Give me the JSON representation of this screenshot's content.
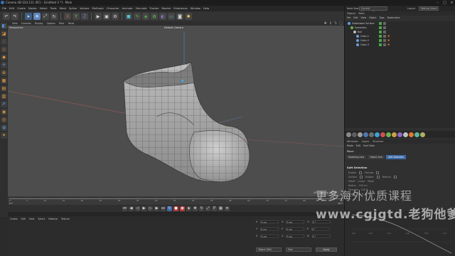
{
  "window": {
    "title": "Cinema 4D S24.111 (RC) - [Untitled 3 *] - Main"
  },
  "menubar": [
    "File",
    "Edit",
    "Create",
    "Modes",
    "Select",
    "Tools",
    "Mesh",
    "Spline",
    "Volume",
    "MoGraph",
    "Character",
    "Animate",
    "Simulate",
    "Tracker",
    "Render",
    "Extensions",
    "Window",
    "Help"
  ],
  "viewport": {
    "menu": [
      "View",
      "Cameras",
      "Display",
      "Options",
      "Filter",
      "Panel"
    ],
    "label": "Perspective",
    "camera": "Default Camera",
    "grid_spacing": "Grid Spacing : 50 cm"
  },
  "timeline": {
    "ticks": [
      "0",
      "5",
      "10",
      "15",
      "20",
      "25",
      "30",
      "35",
      "40",
      "45",
      "50",
      "55",
      "60",
      "65",
      "70",
      "75",
      "80",
      "85",
      "90"
    ],
    "start": "0 F",
    "end": "90 F"
  },
  "materials_menu": [
    "Create",
    "Edit",
    "View",
    "Select",
    "Material",
    "Texture"
  ],
  "coordinates": {
    "rows": [
      {
        "a": "X",
        "av": "0 cm",
        "b": "X",
        "bv": "0 cm",
        "c": "H",
        "cv": "0 °"
      },
      {
        "a": "Y",
        "av": "0 cm",
        "b": "Y",
        "bv": "0 cm",
        "c": "P",
        "cv": "0 °"
      },
      {
        "a": "Z",
        "av": "0 cm",
        "b": "Z",
        "bv": "0 cm",
        "c": "B",
        "cv": "0 °"
      }
    ],
    "mode": "Object (Rel)",
    "size_mode": "Size",
    "apply": "Apply"
  },
  "right_top": {
    "node_space_label": "Node Space",
    "node_space_value": "Current (Standard/Physical)",
    "layout_label": "Layout",
    "layout_value": "Startup (User)"
  },
  "object_tabs": [
    "Objects",
    "Takes"
  ],
  "object_menu": [
    "File",
    "Edit",
    "View",
    "Object",
    "Tags",
    "Bookmarks"
  ],
  "objects": [
    {
      "name": "Subdivision Surface",
      "indent": 0,
      "color": "#5aa3e8"
    },
    {
      "name": "Symmetry",
      "indent": 1,
      "color": "#5fb84b"
    },
    {
      "name": "Null",
      "indent": 2,
      "color": "#bbbbbb"
    },
    {
      "name": "Cubic.1",
      "indent": 3,
      "color": "#6aa0d8"
    },
    {
      "name": "Cubic.2",
      "indent": 3,
      "color": "#6aa0d8"
    },
    {
      "name": "Cubic.3",
      "indent": 3,
      "color": "#6aa0d8"
    }
  ],
  "attr_tabs": [
    "Attributes",
    "Layers",
    "Structure"
  ],
  "attr_menu": [
    "Mode",
    "Edit",
    "User Data"
  ],
  "attr_title": "Move",
  "attr_subtabs": [
    {
      "label": "Modeling Axis",
      "active": false
    },
    {
      "label": "Object Axis",
      "active": false
    },
    {
      "label": "Soft Selection",
      "active": true
    }
  ],
  "soft_selection": {
    "title": "Soft Selection",
    "enable": "Enable",
    "preview": "Preview",
    "surface": "Surface",
    "rubber": "Rubber",
    "restrict": "Restrict",
    "falloff_label": "Falloff",
    "falloff_value": "Linear",
    "mode_label": "Mode",
    "radius_label": "Radius",
    "radius_value": "100 cm",
    "strength_label": "Strength",
    "strength_value": "100 %",
    "width_label": "Width",
    "width_value": "50 %"
  },
  "curve_ticks": [
    "0.0",
    "0.2",
    "0.4",
    "0.6",
    "0.8",
    "1.0"
  ],
  "watermark": {
    "line1": "更多海外优质课程",
    "line2": "www.cgjgtd.老狗他爹"
  }
}
